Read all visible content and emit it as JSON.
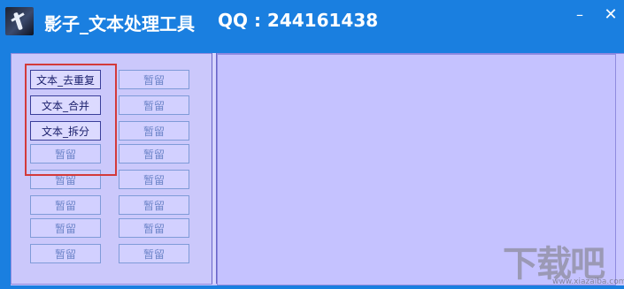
{
  "window": {
    "title": "影子_文本处理工具",
    "qq": "QQ : 244161438",
    "minimize_label": "–",
    "close_label": "✕"
  },
  "buttons_left": [
    {
      "label": "文本_去重复",
      "active": true
    },
    {
      "label": "文本_合并",
      "active": true
    },
    {
      "label": "文本_拆分",
      "active": true
    },
    {
      "label": "暂留",
      "active": false
    },
    {
      "label": "暂留",
      "active": false
    },
    {
      "label": "暂留",
      "active": false
    },
    {
      "label": "暂留",
      "active": false
    },
    {
      "label": "暂留",
      "active": false
    }
  ],
  "buttons_right": [
    {
      "label": "暂留"
    },
    {
      "label": "暂留"
    },
    {
      "label": "暂留"
    },
    {
      "label": "暂留"
    },
    {
      "label": "暂留"
    },
    {
      "label": "暂留"
    },
    {
      "label": "暂留"
    },
    {
      "label": "暂留"
    }
  ],
  "watermark": {
    "logo_text": "下载吧",
    "url_text": "www.xiazaiba.com"
  },
  "colors": {
    "titlebar": "#1a7fe0",
    "panel": "#c9c6ff",
    "highlight": "#d33a3a"
  }
}
